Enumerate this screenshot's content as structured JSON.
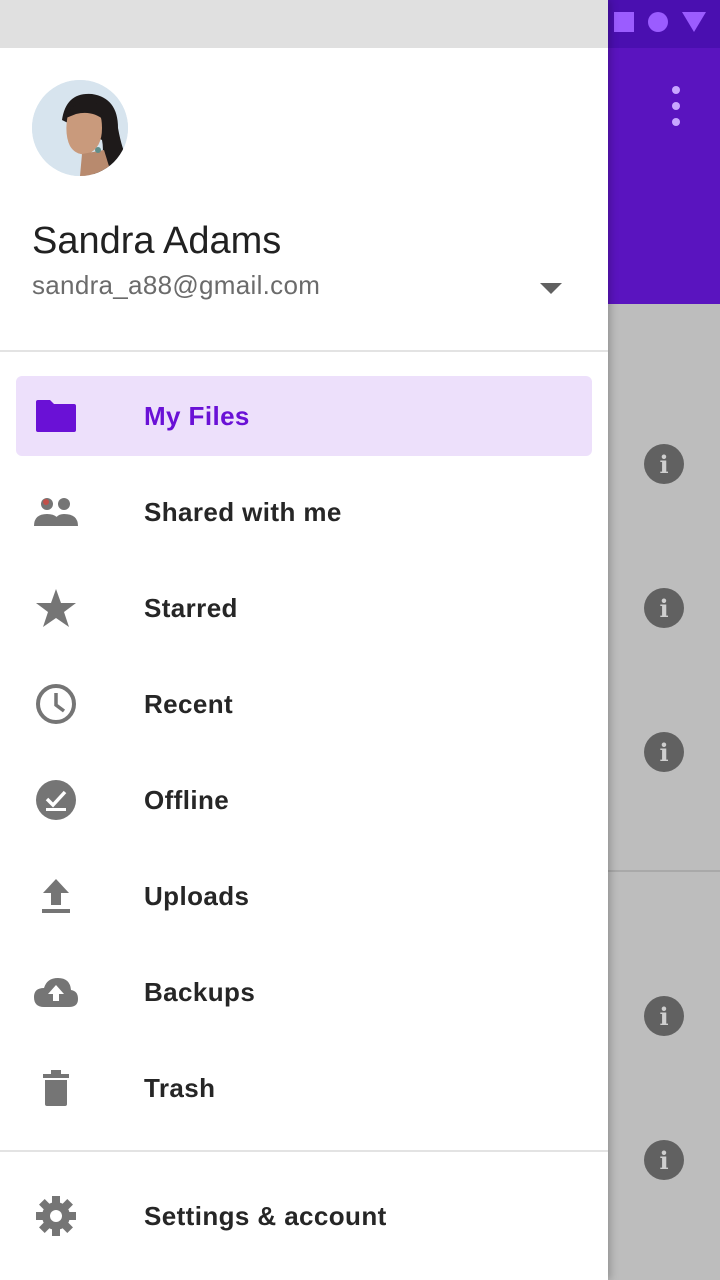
{
  "drawer": {
    "user_name": "Sandra Adams",
    "user_email": "sandra_a88@gmail.com",
    "items": [
      {
        "label": "My Files",
        "icon": "folder-icon",
        "active": true
      },
      {
        "label": "Shared with me",
        "icon": "people-icon"
      },
      {
        "label": "Starred",
        "icon": "star-icon"
      },
      {
        "label": "Recent",
        "icon": "clock-icon"
      },
      {
        "label": "Offline",
        "icon": "offline-check-icon"
      },
      {
        "label": "Uploads",
        "icon": "upload-icon"
      },
      {
        "label": "Backups",
        "icon": "cloud-upload-icon"
      },
      {
        "label": "Trash",
        "icon": "trash-icon"
      }
    ],
    "footer_item": {
      "label": "Settings & account",
      "icon": "gear-icon"
    }
  },
  "colors": {
    "accent": "#6a11d6",
    "active_bg": "#ede0fb",
    "app_bar": "#5a14bf",
    "icon_gray": "#757575"
  }
}
